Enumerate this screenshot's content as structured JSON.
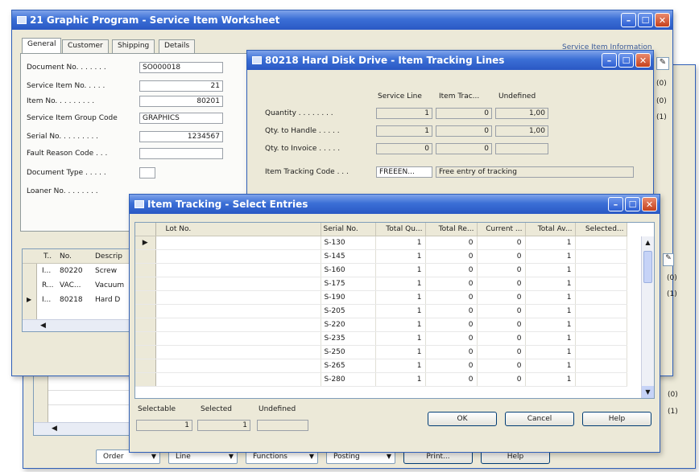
{
  "main_window": {
    "title": "21 Graphic Program - Service Item Worksheet",
    "tabs": [
      "General",
      "Customer",
      "Shipping",
      "Details"
    ],
    "service_item_info": "Service Item Information",
    "info_counts": [
      "(0)",
      "(0)",
      "(1)"
    ],
    "fields": {
      "document_no_label": "Document No. . . . . . .",
      "document_no": "SO000018",
      "service_item_no_label": "Service Item No. . . . .",
      "service_item_no": "21",
      "item_no_label": "Item No. . . . . . . . .",
      "item_no": "80201",
      "service_item_group_label": "Service Item Group Code",
      "service_item_group": "GRAPHICS",
      "serial_no_label": "Serial No. . . . . . . . .",
      "serial_no": "1234567",
      "fault_reason_label": "Fault Reason Code . . .",
      "document_type_label": "Document Type . . . . .",
      "loaner_no_label": "Loaner No. . . . . . . ."
    },
    "lines_headers": [
      "T..",
      "No.",
      "Descrip"
    ],
    "lines": [
      {
        "t": "I...",
        "no": "80220",
        "desc": "Screw"
      },
      {
        "t": "R...",
        "no": "VAC...",
        "desc": "Vacuum"
      },
      {
        "t": "I...",
        "no": "80218",
        "desc": "Hard D"
      }
    ],
    "right_counts": [
      "(0)",
      "(1)"
    ]
  },
  "tracking_window": {
    "title": "80218 Hard Disk Drive - Item Tracking Lines",
    "col_headers": [
      "Service Line",
      "Item Trac...",
      "Undefined"
    ],
    "rows": [
      {
        "label": "Quantity . . . . . . . .",
        "v1": "1",
        "v2": "0",
        "v3": "1,00"
      },
      {
        "label": "Qty. to Handle . . . . .",
        "v1": "1",
        "v2": "0",
        "v3": "1,00"
      },
      {
        "label": "Qty. to Invoice . . . . .",
        "v1": "0",
        "v2": "0",
        "v3": ""
      }
    ],
    "tracking_code_label": "Item Tracking Code . . .",
    "tracking_code": "FREEEN...",
    "tracking_code_desc": "Free entry of tracking"
  },
  "select_window": {
    "title": "Item Tracking - Select Entries",
    "headers": [
      "Lot No.",
      "Serial No.",
      "Total Qu...",
      "Total Re...",
      "Current ...",
      "Total Av...",
      "Selected..."
    ],
    "rows": [
      {
        "serial": "S-130",
        "tq": "1",
        "tr": "0",
        "cur": "0",
        "ta": "1"
      },
      {
        "serial": "S-145",
        "tq": "1",
        "tr": "0",
        "cur": "0",
        "ta": "1"
      },
      {
        "serial": "S-160",
        "tq": "1",
        "tr": "0",
        "cur": "0",
        "ta": "1"
      },
      {
        "serial": "S-175",
        "tq": "1",
        "tr": "0",
        "cur": "0",
        "ta": "1"
      },
      {
        "serial": "S-190",
        "tq": "1",
        "tr": "0",
        "cur": "0",
        "ta": "1"
      },
      {
        "serial": "S-205",
        "tq": "1",
        "tr": "0",
        "cur": "0",
        "ta": "1"
      },
      {
        "serial": "S-220",
        "tq": "1",
        "tr": "0",
        "cur": "0",
        "ta": "1"
      },
      {
        "serial": "S-235",
        "tq": "1",
        "tr": "0",
        "cur": "0",
        "ta": "1"
      },
      {
        "serial": "S-250",
        "tq": "1",
        "tr": "0",
        "cur": "0",
        "ta": "1"
      },
      {
        "serial": "S-265",
        "tq": "1",
        "tr": "0",
        "cur": "0",
        "ta": "1"
      },
      {
        "serial": "S-280",
        "tq": "1",
        "tr": "0",
        "cur": "0",
        "ta": "1"
      }
    ],
    "footer": {
      "selectable_label": "Selectable",
      "selectable": "1",
      "selected_label": "Selected",
      "selected": "1",
      "undefined_label": "Undefined",
      "undefined": ""
    },
    "ok": "OK",
    "cancel": "Cancel",
    "help": "Help"
  },
  "bottom_bar": {
    "order": "Order",
    "line": "Line",
    "functions": "Functions",
    "posting": "Posting",
    "print": "Print...",
    "help": "Help",
    "right_counts": [
      "(0)",
      "(1)"
    ]
  }
}
